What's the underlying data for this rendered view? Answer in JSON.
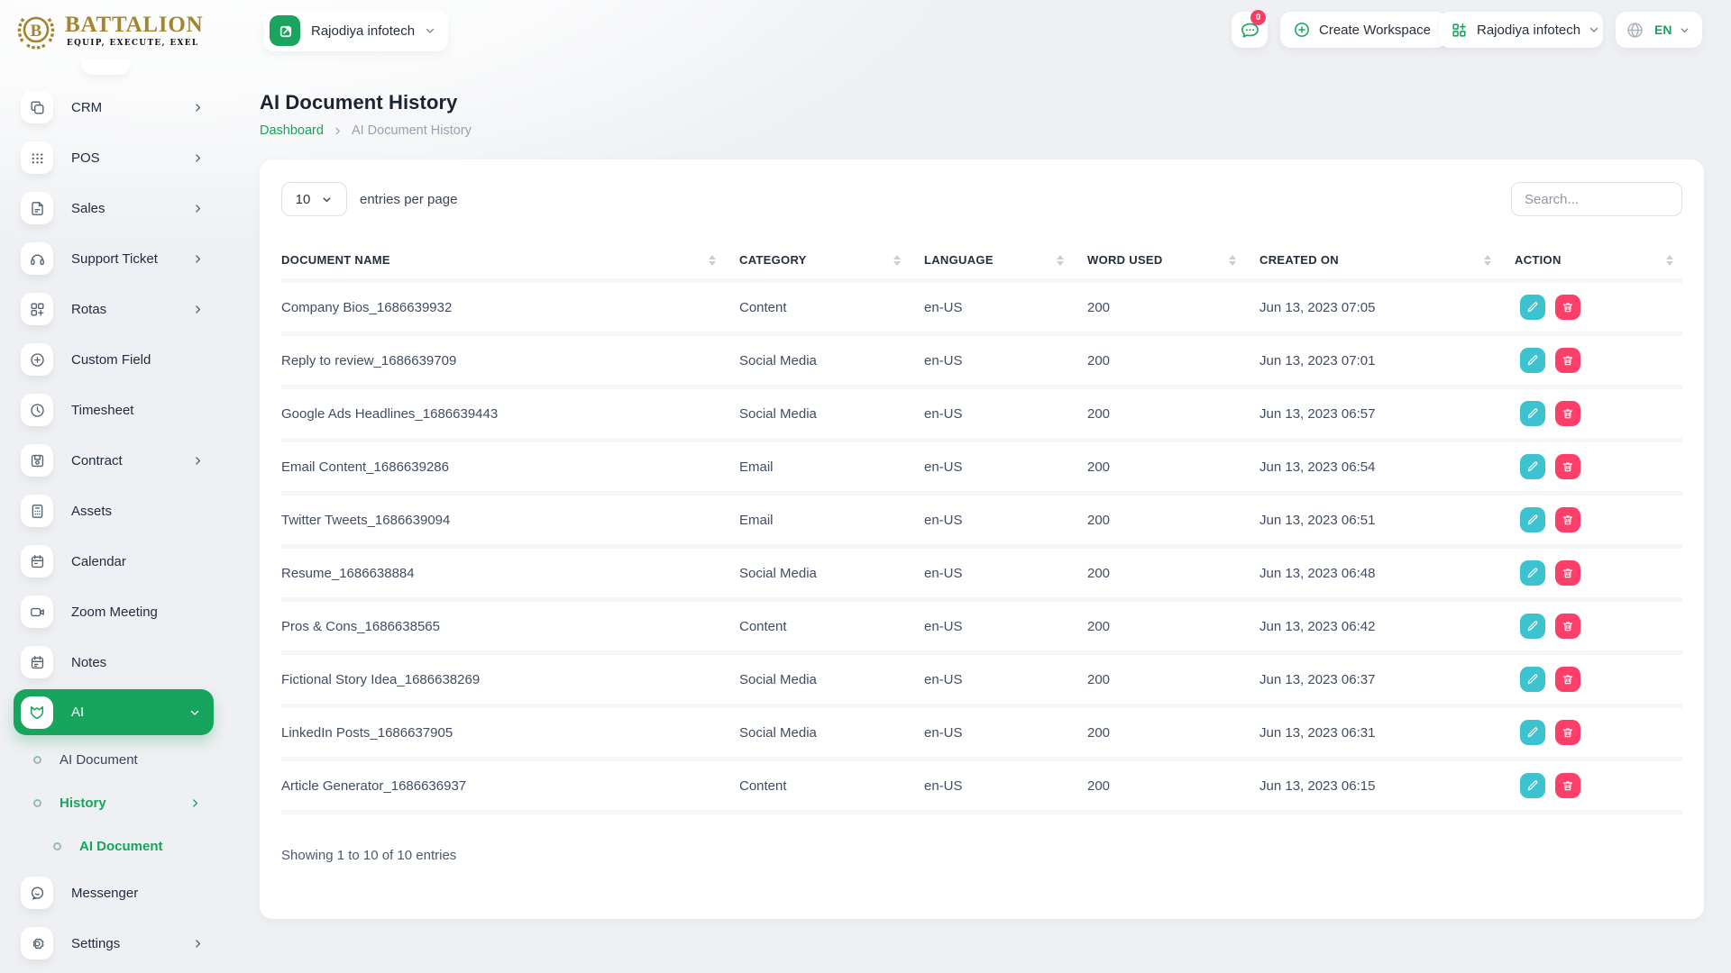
{
  "brand": {
    "name": "BATTALION",
    "tagline": "EQUIP, EXECUTE, EXEL",
    "monogram": "B"
  },
  "header": {
    "workspace_selector": {
      "label": "Rajodiya infotech"
    },
    "messages_badge": "0",
    "create_workspace_label": "Create Workspace",
    "workspace_dropdown": {
      "label": "Rajodiya infotech"
    },
    "language": {
      "code": "EN"
    }
  },
  "page": {
    "title": "AI Document History",
    "breadcrumb": {
      "home": "Dashboard",
      "current": "AI Document History"
    }
  },
  "sidebar": {
    "items": [
      {
        "label": "CRM",
        "icon": "crm-icon",
        "chevron": "right"
      },
      {
        "label": "POS",
        "icon": "pos-icon",
        "chevron": "right"
      },
      {
        "label": "Sales",
        "icon": "sales-icon",
        "chevron": "right"
      },
      {
        "label": "Support Ticket",
        "icon": "support-ticket-icon",
        "chevron": "right"
      },
      {
        "label": "Rotas",
        "icon": "rotas-icon",
        "chevron": "right"
      },
      {
        "label": "Custom Field",
        "icon": "custom-field-icon",
        "chevron": "none"
      },
      {
        "label": "Timesheet",
        "icon": "timesheet-icon",
        "chevron": "none"
      },
      {
        "label": "Contract",
        "icon": "contract-icon",
        "chevron": "right"
      },
      {
        "label": "Assets",
        "icon": "assets-icon",
        "chevron": "none"
      },
      {
        "label": "Calendar",
        "icon": "calendar-icon",
        "chevron": "none"
      },
      {
        "label": "Zoom Meeting",
        "icon": "zoom-meeting-icon",
        "chevron": "none"
      },
      {
        "label": "Notes",
        "icon": "notes-icon",
        "chevron": "none"
      },
      {
        "label": "AI",
        "icon": "ai-icon",
        "chevron": "down",
        "active": true
      },
      {
        "label": "AI Document",
        "type": "sub",
        "level": 1
      },
      {
        "label": "History",
        "type": "sub",
        "level": 1,
        "active": true,
        "chevron": "right"
      },
      {
        "label": "AI Document",
        "type": "sub",
        "level": 2,
        "active": true
      },
      {
        "label": "Messenger",
        "icon": "messenger-icon",
        "chevron": "none"
      },
      {
        "label": "Settings",
        "icon": "settings-icon",
        "chevron": "right"
      }
    ]
  },
  "table": {
    "entries_per_page": "10",
    "entries_label": "entries per page",
    "search_placeholder": "Search...",
    "columns": [
      "DOCUMENT NAME",
      "CATEGORY",
      "LANGUAGE",
      "WORD USED",
      "CREATED ON",
      "ACTION"
    ],
    "rows": [
      {
        "name": "Company Bios_1686639932",
        "category": "Content",
        "language": "en-US",
        "words": "200",
        "created": "Jun 13, 2023 07:05"
      },
      {
        "name": "Reply to review_1686639709",
        "category": "Social Media",
        "language": "en-US",
        "words": "200",
        "created": "Jun 13, 2023 07:01"
      },
      {
        "name": "Google Ads Headlines_1686639443",
        "category": "Social Media",
        "language": "en-US",
        "words": "200",
        "created": "Jun 13, 2023 06:57"
      },
      {
        "name": "Email Content_1686639286",
        "category": "Email",
        "language": "en-US",
        "words": "200",
        "created": "Jun 13, 2023 06:54"
      },
      {
        "name": "Twitter Tweets_1686639094",
        "category": "Email",
        "language": "en-US",
        "words": "200",
        "created": "Jun 13, 2023 06:51"
      },
      {
        "name": "Resume_1686638884",
        "category": "Social Media",
        "language": "en-US",
        "words": "200",
        "created": "Jun 13, 2023 06:48"
      },
      {
        "name": "Pros & Cons_1686638565",
        "category": "Content",
        "language": "en-US",
        "words": "200",
        "created": "Jun 13, 2023 06:42"
      },
      {
        "name": "Fictional Story Idea_1686638269",
        "category": "Social Media",
        "language": "en-US",
        "words": "200",
        "created": "Jun 13, 2023 06:37"
      },
      {
        "name": "LinkedIn Posts_1686637905",
        "category": "Social Media",
        "language": "en-US",
        "words": "200",
        "created": "Jun 13, 2023 06:31"
      },
      {
        "name": "Article Generator_1686636937",
        "category": "Content",
        "language": "en-US",
        "words": "200",
        "created": "Jun 13, 2023 06:15"
      }
    ],
    "footer": "Showing 1 to 10 of 10 entries"
  },
  "colors": {
    "primary": "#17a45c",
    "info": "#3cc3cf",
    "danger": "#fc3f68",
    "gold": "#a3852f"
  }
}
